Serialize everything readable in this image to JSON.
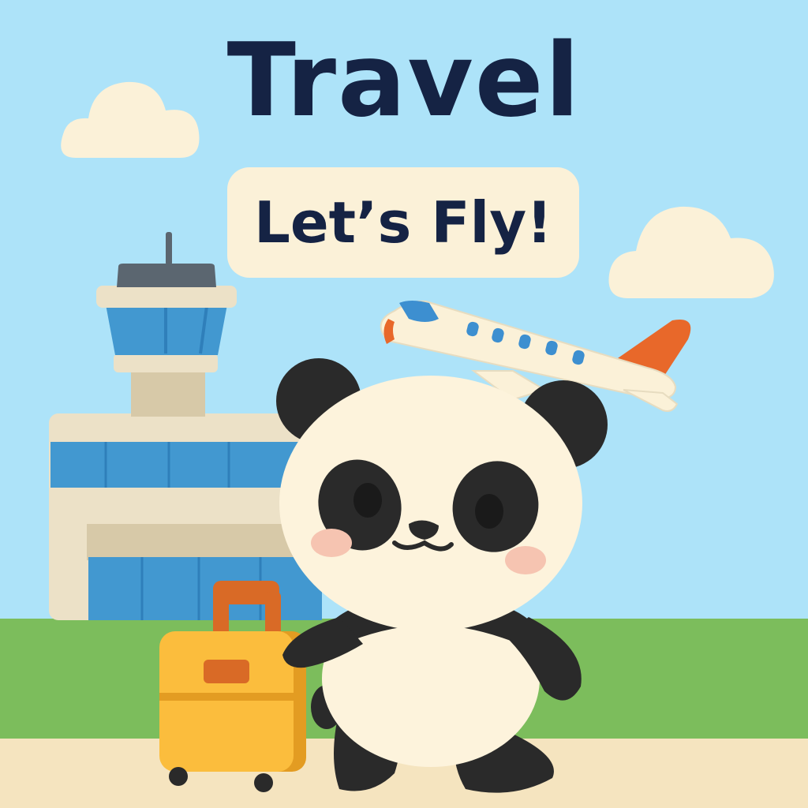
{
  "poster": {
    "title": "Travel",
    "subtitle": "Let’s Fly!"
  },
  "colors": {
    "sky": "#ade3f9",
    "cloud": "#fbf1d8",
    "title_text": "#152344",
    "pill": "#fbf1d8",
    "grass": "#7cbd5c",
    "ground": "#f5e4bf",
    "building": "#ece1c7",
    "building_shadow": "#d7c9a8",
    "glass": "#4298d0",
    "glass_dark": "#2f7fba",
    "tower_cap": "#5b6670",
    "plane_body": "#fbf1d8",
    "plane_tail": "#e8682a",
    "plane_window": "#3d8fd0",
    "suitcase": "#fbbd3d",
    "suitcase_dark": "#e39c22",
    "suitcase_handle": "#d96a26",
    "panda_white": "#fdf3dc",
    "panda_black": "#2a2a2a",
    "cheek": "#f6c4b1"
  },
  "illustration": {
    "character": "panda-icon",
    "props": [
      "suitcase-icon",
      "airplane-icon",
      "control-tower-icon",
      "cloud-icon"
    ]
  }
}
